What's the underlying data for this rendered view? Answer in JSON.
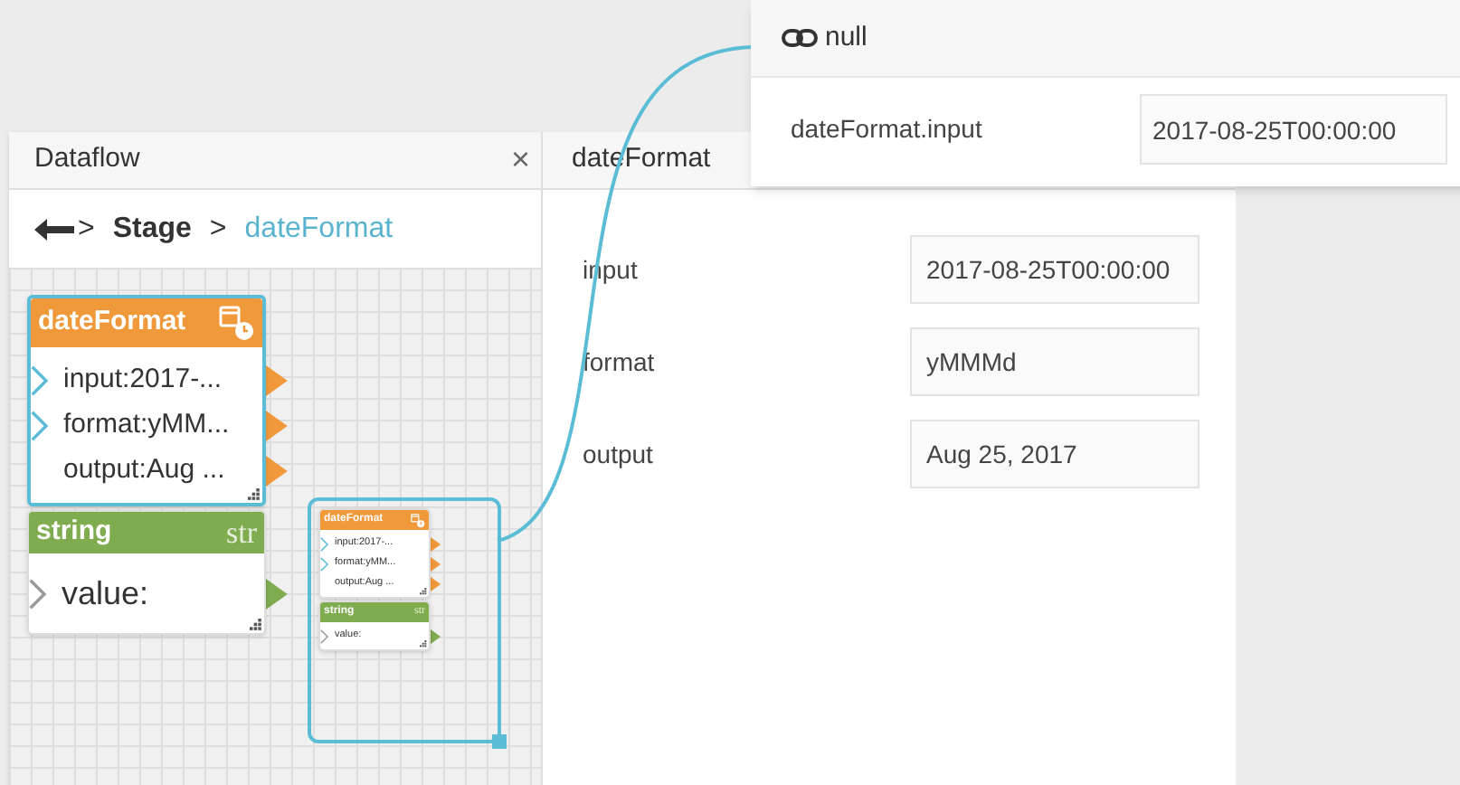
{
  "dataflow_panel": {
    "title": "Dataflow",
    "close": "×",
    "back_separator": ">",
    "breadcrumb": [
      {
        "label": "Stage",
        "selected": false
      },
      {
        "separator": ">",
        "label": "dateFormat",
        "selected": true
      }
    ]
  },
  "canvas": {
    "nodes": [
      {
        "kind": "date",
        "title": "dateFormat",
        "selected": true,
        "ports": [
          {
            "label": "input:2017-...",
            "in_port": true,
            "out_port": true
          },
          {
            "label": "format:yMM...",
            "in_port": true,
            "out_port": true
          },
          {
            "label": "output:Aug ...",
            "in_port": false,
            "out_port": true
          }
        ]
      },
      {
        "kind": "string",
        "title": "string",
        "type_label": "str",
        "selected": false,
        "ports": [
          {
            "label": "value:",
            "in_port": true,
            "out_port": true
          }
        ]
      }
    ],
    "group": {
      "nodes": [
        {
          "kind": "date",
          "title": "dateFormat",
          "ports": [
            {
              "label": "input:2017-...",
              "in_port": true,
              "out_port": true
            },
            {
              "label": "format:yMM...",
              "in_port": true,
              "out_port": true
            },
            {
              "label": "output:Aug ...",
              "in_port": false,
              "out_port": true
            }
          ]
        },
        {
          "kind": "string",
          "title": "string",
          "type_label": "str",
          "ports": [
            {
              "label": "value:",
              "in_port": true,
              "out_port": true
            }
          ]
        }
      ]
    }
  },
  "properties_panel": {
    "title": "dateFormat",
    "fields": [
      {
        "label": "input",
        "value": "2017-08-25T00:00:00"
      },
      {
        "label": "format",
        "value": "yMMMd"
      },
      {
        "label": "output",
        "value": "Aug 25, 2017"
      }
    ]
  },
  "binding_popup": {
    "title": "null",
    "fields": [
      {
        "label": "dateFormat.input",
        "value": "2017-08-25T00:00:00"
      }
    ]
  }
}
